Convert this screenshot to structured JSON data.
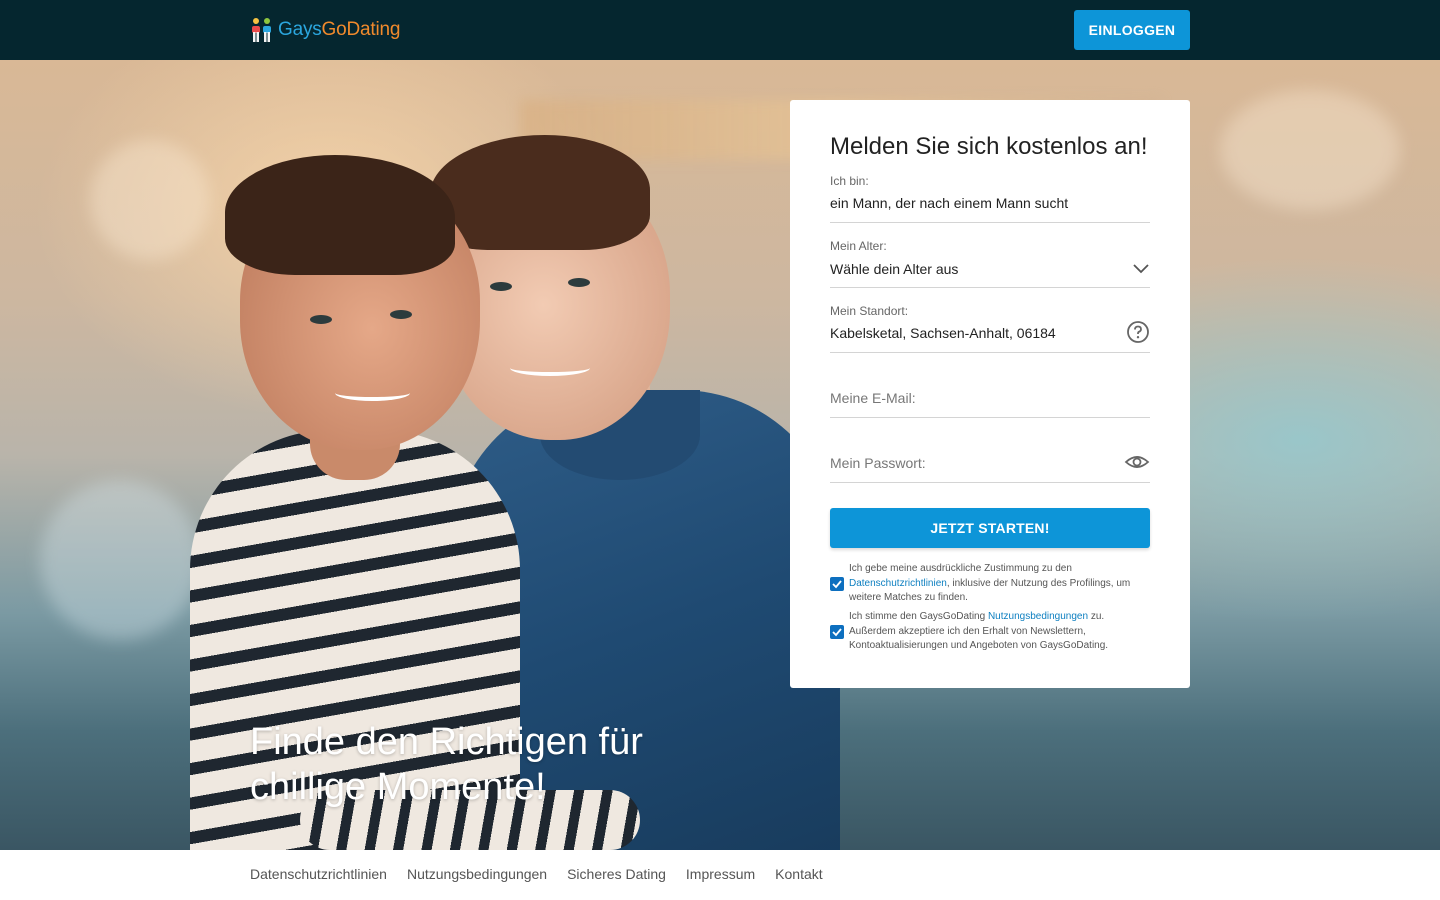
{
  "header": {
    "logo_part1": "Gays",
    "logo_part2": "GoDating",
    "login_label": "EINLOGGEN"
  },
  "hero": {
    "tagline_line1": "Finde den Richtigen für",
    "tagline_line2": "chillige Momente!"
  },
  "form": {
    "title": "Melden Sie sich kostenlos an!",
    "iam_label": "Ich bin:",
    "iam_value": "ein Mann, der nach einem Mann sucht",
    "age_label": "Mein Alter:",
    "age_value": "Wähle dein Alter aus",
    "location_label": "Mein Standort:",
    "location_value": "Kabelsketal, Sachsen-Anhalt, 06184",
    "email_placeholder": "Meine E-Mail:",
    "password_placeholder": "Mein Passwort:",
    "submit_label": "JETZT STARTEN!",
    "consent1": {
      "text_a": "Ich gebe meine ausdrückliche Zustimmung zu den",
      "link": "Datenschutzrichtlinien",
      "text_b": ", inklusive der Nutzung des Profilings, um weitere Matches zu finden.",
      "checked": true
    },
    "consent2": {
      "text_a": "Ich stimme den GaysGoDating ",
      "link": "Nutzungsbedingungen",
      "text_b": " zu. Außerdem akzeptiere ich den Erhalt von Newslettern, Kontoaktualisierungen und Angeboten von GaysGoDating.",
      "checked": true
    }
  },
  "footer": {
    "links": [
      "Datenschutzrichtlinien",
      "Nutzungsbedingungen",
      "Sicheres Dating",
      "Impressum",
      "Kontakt"
    ]
  },
  "colors": {
    "header_bg": "#05262f",
    "accent": "#0d95d8",
    "logo_blue": "#2ba6de",
    "logo_orange": "#f18a2c"
  },
  "icons": {
    "logo": "couple-figures-icon",
    "age_select": "chevron-down-icon",
    "location_help": "question-circle-icon",
    "password_toggle": "eye-icon",
    "checkbox": "check-icon"
  }
}
